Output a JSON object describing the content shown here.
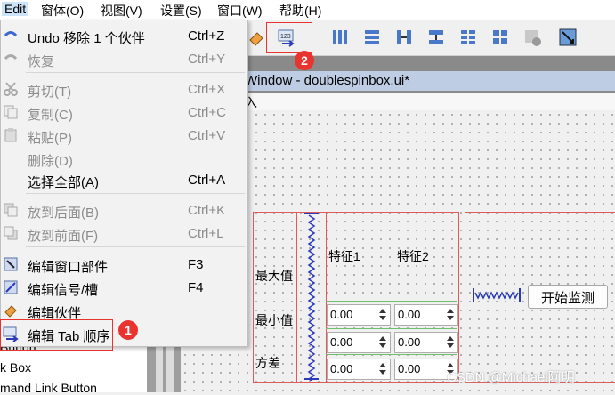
{
  "menubar": {
    "items": [
      "Edit",
      "窗体(O)",
      "视图(V)",
      "设置(S)",
      "窗口(W)",
      "帮助(H)"
    ]
  },
  "context_menu": {
    "items": [
      {
        "label": "Undo 移除 1 个伙伴",
        "shortcut": "Ctrl+Z",
        "disabled": false,
        "icon": "undo-icon"
      },
      {
        "label": "恢复",
        "shortcut": "Ctrl+Y",
        "disabled": true,
        "icon": "redo-icon"
      },
      {
        "label": "剪切(T)",
        "shortcut": "Ctrl+X",
        "disabled": true,
        "icon": "cut-icon"
      },
      {
        "label": "复制(C)",
        "shortcut": "Ctrl+C",
        "disabled": true,
        "icon": "copy-icon"
      },
      {
        "label": "粘贴(P)",
        "shortcut": "Ctrl+V",
        "disabled": true,
        "icon": "paste-icon"
      },
      {
        "label": "删除(D)",
        "shortcut": "",
        "disabled": true,
        "icon": ""
      },
      {
        "label": "选择全部(A)",
        "shortcut": "Ctrl+A",
        "disabled": false,
        "icon": ""
      },
      {
        "label": "放到后面(B)",
        "shortcut": "Ctrl+K",
        "disabled": true,
        "icon": "send-to-back-icon"
      },
      {
        "label": "放到前面(F)",
        "shortcut": "Ctrl+L",
        "disabled": true,
        "icon": "bring-to-front-icon"
      },
      {
        "label": "编辑窗口部件",
        "shortcut": "F3",
        "disabled": false,
        "icon": "edit-widgets-icon"
      },
      {
        "label": "编辑信号/槽",
        "shortcut": "F4",
        "disabled": false,
        "icon": "edit-signals-slots-icon"
      },
      {
        "label": "编辑伙伴",
        "shortcut": "",
        "disabled": false,
        "icon": "edit-buddies-icon"
      },
      {
        "label": "编辑 Tab 顺序",
        "shortcut": "",
        "disabled": false,
        "icon": "edit-tab-order-icon"
      }
    ]
  },
  "widget_box": {
    "items": [
      "Button",
      "k Box",
      "mand Link Button"
    ]
  },
  "form": {
    "title": "Window - doublespinbox.ui*",
    "menu_placeholder": "入",
    "headers": [
      "特征1",
      "特征2"
    ],
    "row_labels": [
      "最大值",
      "最小值",
      "方差"
    ],
    "spin_values": [
      [
        "0.00",
        "0.00"
      ],
      [
        "0.00",
        "0.00"
      ],
      [
        "0.00",
        "0.00"
      ]
    ],
    "start_button": "开始监测"
  },
  "annotations": {
    "badge1": "1",
    "badge2": "2"
  },
  "watermark": "CSDN @Michael阿明",
  "colors": {
    "highlight": "#e8332f",
    "layout_red": "#e05a5a",
    "layout_green": "#6fbf6f",
    "spacer_blue": "#2a3ab8"
  }
}
